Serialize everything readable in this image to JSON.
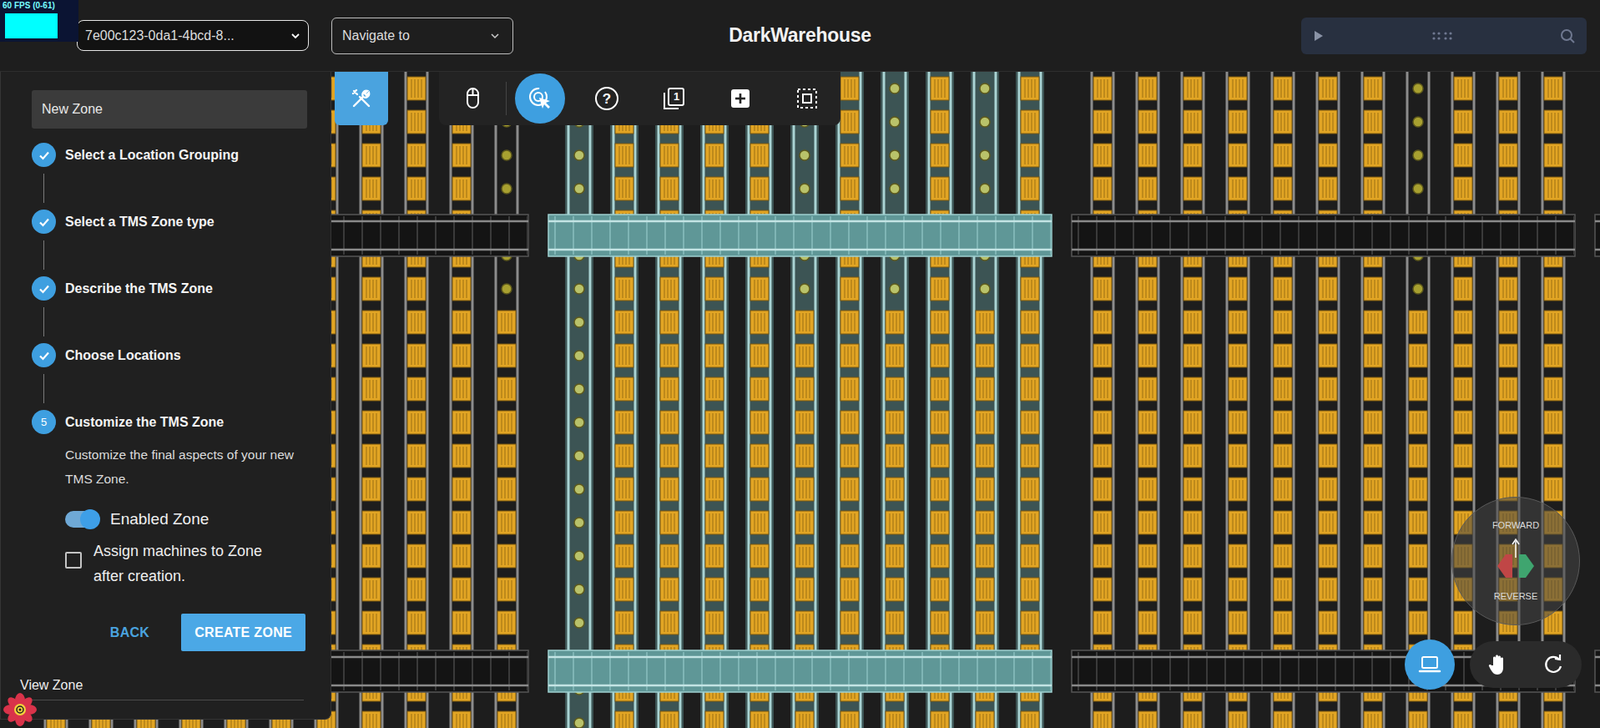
{
  "fps": {
    "label": "60 FPS (0-61)"
  },
  "header": {
    "warehouse": "7e00c123-0da1-4bcd-8...",
    "navigate": "Navigate to",
    "title": "DarkWarehouse"
  },
  "toolbar": {
    "tools_open": true,
    "tools": [
      {
        "kind": "mouse",
        "selected": false
      },
      {
        "kind": "pick",
        "selected": true
      },
      {
        "kind": "help",
        "selected": false,
        "glyph": "?"
      },
      {
        "kind": "layers",
        "selected": false,
        "glyph": "1"
      },
      {
        "kind": "add",
        "selected": false
      },
      {
        "kind": "area",
        "selected": false
      }
    ]
  },
  "panel": {
    "zone_name": "New Zone",
    "steps": [
      {
        "label": "Select a Location Grouping",
        "done": true
      },
      {
        "label": "Select a TMS Zone type",
        "done": true
      },
      {
        "label": "Describe the TMS Zone",
        "done": true
      },
      {
        "label": "Choose Locations",
        "done": true
      },
      {
        "label": "Customize the TMS Zone",
        "done": false,
        "number": "5"
      }
    ],
    "description": "Customize the final aspects of your new TMS Zone.",
    "toggle": {
      "label": "Enabled Zone",
      "on": true
    },
    "checkbox": {
      "label": "Assign machines to Zone after creation.",
      "checked": false
    },
    "back": "BACK",
    "create": "CREATE ZONE",
    "next_step": "View Zone"
  },
  "canvas": {
    "sections": [
      {
        "selected": false,
        "columns": [
          {
            "kind": "bins"
          },
          {
            "kind": "bins"
          },
          {
            "kind": "bins"
          },
          {
            "kind": "bins"
          },
          {
            "kind": "bins"
          },
          {
            "kind": "bins"
          },
          {
            "kind": "bins"
          },
          {
            "kind": "bins"
          },
          {
            "kind": "bins"
          },
          {
            "kind": "bins"
          },
          {
            "kind": "mixed"
          }
        ]
      },
      {
        "selected": true,
        "columns": [
          {
            "kind": "dots"
          },
          {
            "kind": "bins"
          },
          {
            "kind": "bins"
          },
          {
            "kind": "bins"
          },
          {
            "kind": "bins"
          },
          {
            "kind": "mixed"
          },
          {
            "kind": "bins"
          },
          {
            "kind": "mixed"
          },
          {
            "kind": "bins"
          },
          {
            "kind": "mixed"
          },
          {
            "kind": "bins"
          }
        ]
      },
      {
        "selected": false,
        "columns": [
          {
            "kind": "bins"
          },
          {
            "kind": "bins"
          },
          {
            "kind": "bins"
          },
          {
            "kind": "bins"
          },
          {
            "kind": "bins"
          },
          {
            "kind": "bins"
          },
          {
            "kind": "bins"
          },
          {
            "kind": "mixed"
          },
          {
            "kind": "bins"
          },
          {
            "kind": "bins"
          },
          {
            "kind": "bins"
          }
        ]
      },
      {
        "selected": false,
        "columns": []
      }
    ]
  },
  "direction": {
    "forward": "FORWARD",
    "reverse": "REVERSE"
  },
  "view_controls": [
    {
      "kind": "laptop",
      "selected": true
    },
    {
      "kind": "hand",
      "selected": false
    },
    {
      "kind": "rotate",
      "selected": false
    }
  ]
}
